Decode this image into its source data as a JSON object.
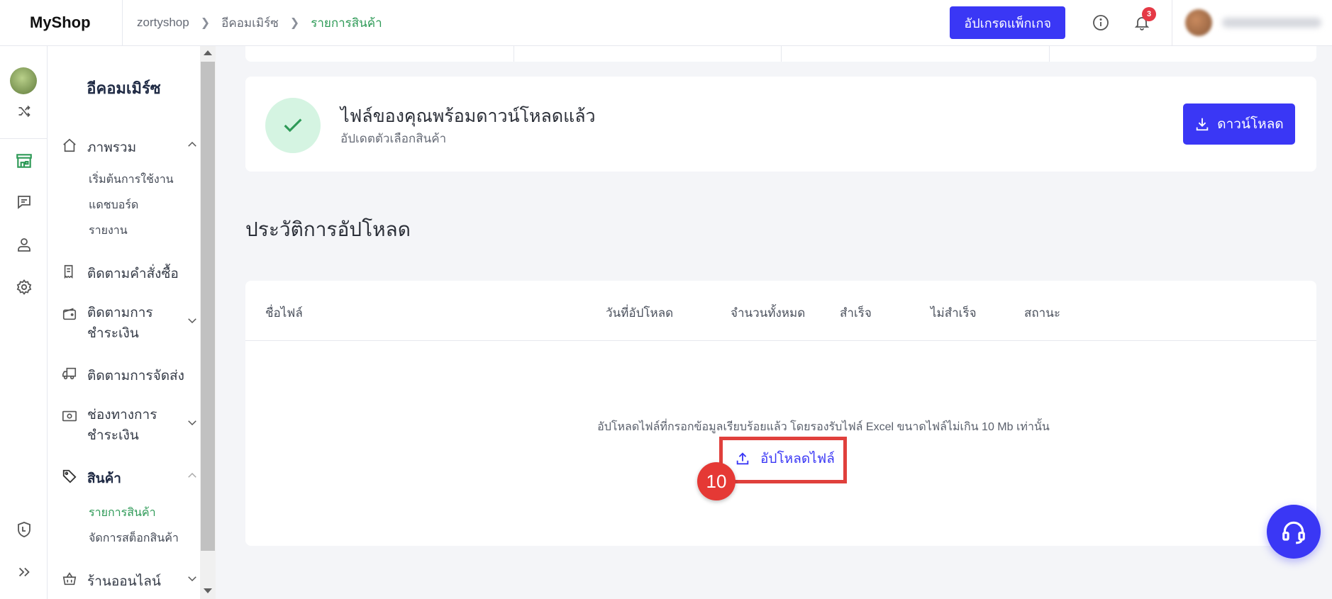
{
  "brand": "MyShop",
  "breadcrumb": {
    "shop": "zortyshop",
    "section": "อีคอมเมิร์ซ",
    "current": "รายการสินค้า"
  },
  "topbar": {
    "upgrade_label": "อัปเกรดแพ็กเกจ",
    "notification_count": "3"
  },
  "sidebar": {
    "title": "อีคอมเมิร์ซ",
    "overview": "ภาพรวม",
    "overview_subs": [
      "เริ่มต้นการใช้งาน",
      "แดชบอร์ด",
      "รายงาน"
    ],
    "orders": "ติดตามคำสั่งซื้อ",
    "payments_l1": "ติดตามการ",
    "payments_l2": "ชำระเงิน",
    "shipping": "ติดตามการจัดส่ง",
    "channels_l1": "ช่องทางการ",
    "channels_l2": "ชำระเงิน",
    "products": "สินค้า",
    "product_subs": [
      "รายการสินค้า",
      "จัดการสต็อกสินค้า"
    ],
    "online_store": "ร้านออนไลน์"
  },
  "ready_card": {
    "title": "ไฟล์ของคุณพร้อมดาวน์โหลดแล้ว",
    "subtitle": "อัปเดตตัวเลือกสินค้า",
    "download_label": "ดาวน์โหลด"
  },
  "history": {
    "title": "ประวัติการอัปโหลด",
    "columns": [
      "ชื่อไฟล์",
      "วันที่อัปโหลด",
      "จำนวนทั้งหมด",
      "สำเร็จ",
      "ไม่สำเร็จ",
      "สถานะ"
    ],
    "empty_message": "อัปโหลดไฟล์ที่กรอกข้อมูลเรียบร้อยแล้ว โดยรองรับไฟล์ Excel ขนาดไฟล์ไม่เกิน 10 Mb เท่านั้น",
    "upload_label": "อัปโหลดไฟล์"
  },
  "annotation": {
    "step_number": "10"
  },
  "colors": {
    "primary": "#3a37f5",
    "active_green": "#2e9a57",
    "highlight_red": "#e0403c"
  }
}
